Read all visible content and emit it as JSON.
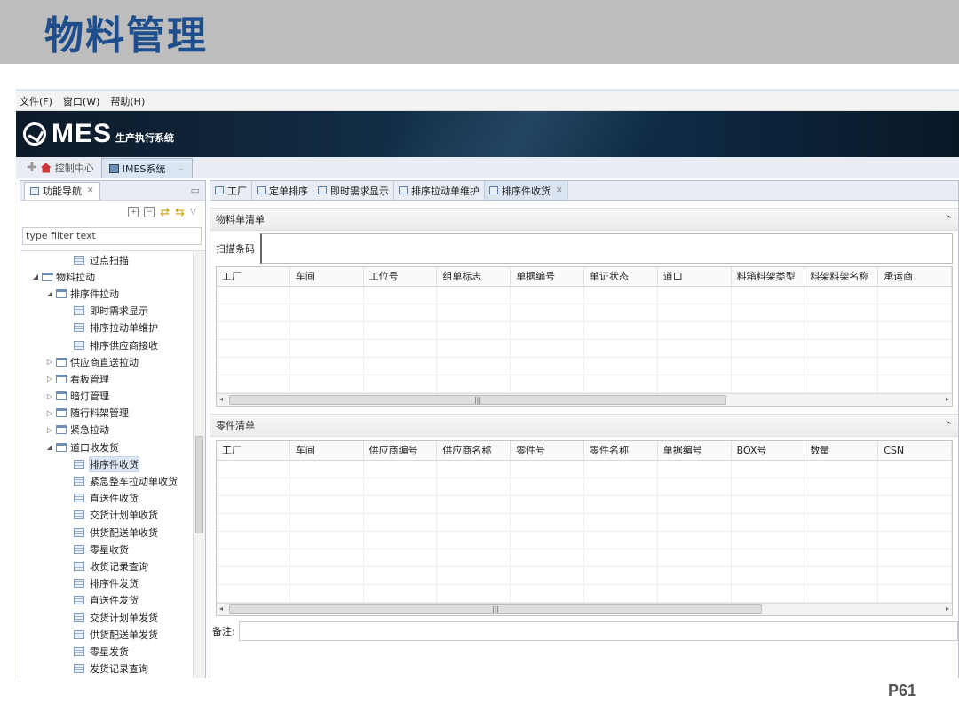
{
  "slide": {
    "title": "物料管理",
    "page": "P61"
  },
  "menubar": [
    "文件(F)",
    "窗口(W)",
    "帮助(H)"
  ],
  "banner": {
    "logo_text": "MES",
    "subtitle": "生产执行系统"
  },
  "top_tabs": [
    {
      "label": "控制中心"
    },
    {
      "label": "IMES系统"
    }
  ],
  "left_panel": {
    "tab_label": "功能导航",
    "filter_placeholder": "type filter text",
    "tree": [
      {
        "label": "过点扫描",
        "level": 2,
        "type": "leaf"
      },
      {
        "label": "物料拉动",
        "level": 0,
        "type": "folder",
        "expanded": true
      },
      {
        "label": "排序件拉动",
        "level": 1,
        "type": "folder",
        "expanded": true
      },
      {
        "label": "即时需求显示",
        "level": 2,
        "type": "leaf"
      },
      {
        "label": "排序拉动单维护",
        "level": 2,
        "type": "leaf"
      },
      {
        "label": "排序供应商接收",
        "level": 2,
        "type": "leaf"
      },
      {
        "label": "供应商直送拉动",
        "level": 1,
        "type": "folder",
        "expanded": false
      },
      {
        "label": "看板管理",
        "level": 1,
        "type": "folder",
        "expanded": false
      },
      {
        "label": "暗灯管理",
        "level": 1,
        "type": "folder",
        "expanded": false
      },
      {
        "label": "随行料架管理",
        "level": 1,
        "type": "folder",
        "expanded": false
      },
      {
        "label": "紧急拉动",
        "level": 1,
        "type": "folder",
        "expanded": false
      },
      {
        "label": "道口收发货",
        "level": 1,
        "type": "folder",
        "expanded": true
      },
      {
        "label": "排序件收货",
        "level": 2,
        "type": "leaf",
        "selected": true
      },
      {
        "label": "紧急整车拉动单收货",
        "level": 2,
        "type": "leaf"
      },
      {
        "label": "直送件收货",
        "level": 2,
        "type": "leaf"
      },
      {
        "label": "交货计划单收货",
        "level": 2,
        "type": "leaf"
      },
      {
        "label": "供货配送单收货",
        "level": 2,
        "type": "leaf"
      },
      {
        "label": "零星收货",
        "level": 2,
        "type": "leaf"
      },
      {
        "label": "收货记录查询",
        "level": 2,
        "type": "leaf"
      },
      {
        "label": "排序件发货",
        "level": 2,
        "type": "leaf"
      },
      {
        "label": "直送件发货",
        "level": 2,
        "type": "leaf"
      },
      {
        "label": "交货计划单发货",
        "level": 2,
        "type": "leaf"
      },
      {
        "label": "供货配送单发货",
        "level": 2,
        "type": "leaf"
      },
      {
        "label": "零星发货",
        "level": 2,
        "type": "leaf"
      },
      {
        "label": "发货记录查询",
        "level": 2,
        "type": "leaf"
      }
    ]
  },
  "editor_tabs": [
    "工厂",
    "定单排序",
    "即时需求显示",
    "排序拉动单维护",
    "排序件收货"
  ],
  "material_section": {
    "title": "物料单清单",
    "scan_label": "扫描条码",
    "columns": [
      "工厂",
      "车间",
      "工位号",
      "组单标志",
      "单据编号",
      "单证状态",
      "道口",
      "料箱料架类型",
      "料架料架名称",
      "承运商"
    ]
  },
  "parts_section": {
    "title": "零件清单",
    "columns": [
      "工厂",
      "车间",
      "供应商编号",
      "供应商名称",
      "零件号",
      "零件名称",
      "单据编号",
      "BOX号",
      "数量",
      "CSN"
    ]
  },
  "note": {
    "label": "备注:"
  }
}
